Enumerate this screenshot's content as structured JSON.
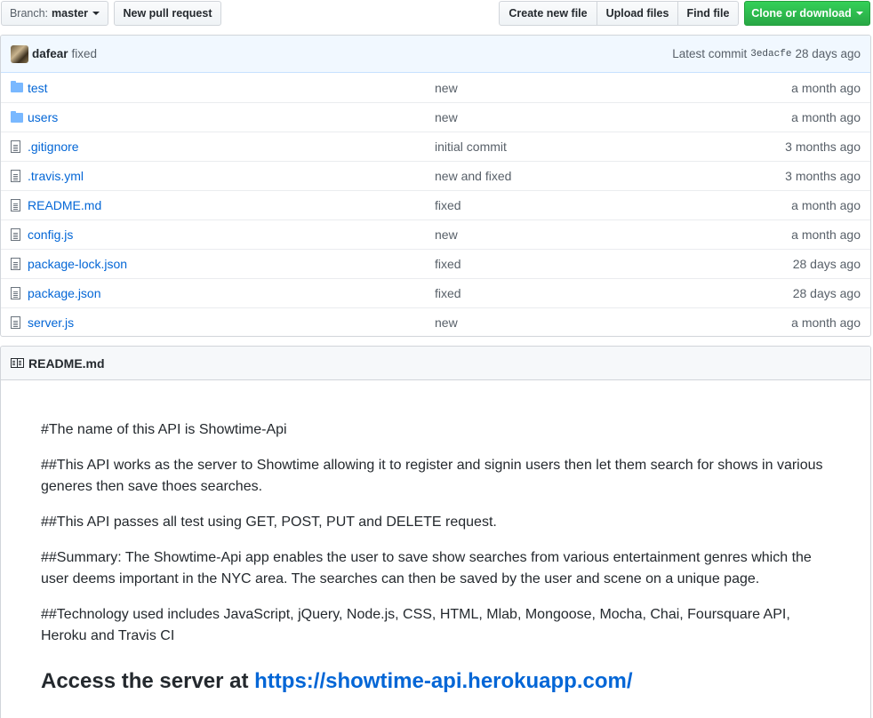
{
  "toolbar": {
    "branch_prefix": "Branch:",
    "branch_name": "master",
    "new_pr": "New pull request",
    "create_file": "Create new file",
    "upload_files": "Upload files",
    "find_file": "Find file",
    "clone": "Clone or download"
  },
  "commit": {
    "author": "dafear",
    "message": "fixed",
    "latest_label": "Latest commit",
    "sha": "3edacfe",
    "ago": "28 days ago"
  },
  "files": [
    {
      "type": "folder",
      "name": "test",
      "message": "new",
      "age": "a month ago"
    },
    {
      "type": "folder",
      "name": "users",
      "message": "new",
      "age": "a month ago"
    },
    {
      "type": "file",
      "name": ".gitignore",
      "message": "initial commit",
      "age": "3 months ago"
    },
    {
      "type": "file",
      "name": ".travis.yml",
      "message": "new and fixed",
      "age": "3 months ago"
    },
    {
      "type": "file",
      "name": "README.md",
      "message": "fixed",
      "age": "a month ago"
    },
    {
      "type": "file",
      "name": "config.js",
      "message": "new",
      "age": "a month ago"
    },
    {
      "type": "file",
      "name": "package-lock.json",
      "message": "fixed",
      "age": "28 days ago"
    },
    {
      "type": "file",
      "name": "package.json",
      "message": "fixed",
      "age": "28 days ago"
    },
    {
      "type": "file",
      "name": "server.js",
      "message": "new",
      "age": "a month ago"
    }
  ],
  "readme": {
    "title": "README.md",
    "paragraphs": [
      "#The name of this API is Showtime-Api",
      "##This API works as the server to Showtime allowing it to register and signin users then let them search for shows in various generes then save thoes searches.",
      "##This API passes all test using GET, POST, PUT and DELETE request.",
      "##Summary: The Showtime-Api app enables the user to save show searches from various entertainment genres which the user deems important in the NYC area. The searches can then be saved by the user and scene on a unique page.",
      "##Technology used includes JavaScript, jQuery, Node.js, CSS, HTML, Mlab, Mongoose, Mocha, Chai, Foursquare API, Heroku and Travis CI"
    ],
    "access_prefix": "Access the server at",
    "access_link": "https://showtime-api.herokuapp.com/"
  }
}
